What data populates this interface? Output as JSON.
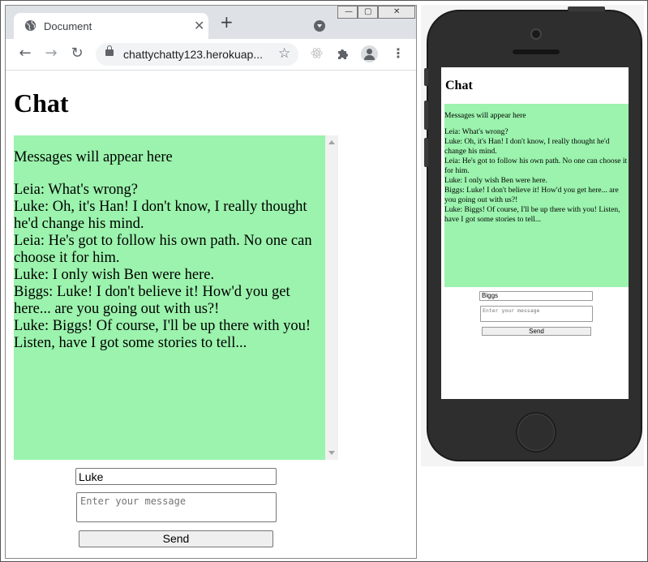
{
  "browser": {
    "tab_title": "Document",
    "tab_close": "✕",
    "new_tab": "+",
    "url": "chattychatty123.herokuap...",
    "back": "←",
    "forward": "→",
    "reload": "↻",
    "bookmark": "☆",
    "window_min": "—",
    "window_max": "▢",
    "window_close": "✕",
    "menu": "⋮"
  },
  "app": {
    "title": "Chat",
    "messages_placeholder": "Messages will appear here",
    "messages": [
      "Leia: What's wrong?",
      "Luke: Oh, it's Han! I don't know, I really thought he'd change his mind.",
      "Leia: He's got to follow his own path. No one can choose it for him.",
      "Luke: I only wish Ben were here.",
      "Biggs: Luke! I don't believe it! How'd you get here... are you going out with us?!",
      "Luke: Biggs! Of course, I'll be up there with you! Listen, have I got some stories to tell..."
    ],
    "name_value": "Luke",
    "message_placeholder": "Enter your message",
    "send_label": "Send"
  },
  "phone_app": {
    "title": "Chat",
    "messages_placeholder": "Messages will appear here",
    "messages": [
      "Leia: What's wrong?",
      "Luke: Oh, it's Han! I don't know, I really thought he'd change his mind.",
      "Leia: He's got to follow his own path. No one can choose it for him.",
      "Luke: I only wish Ben were here.",
      "Biggs: Luke! I don't believe it! How'd you get here... are you going out with us?!",
      "Luke: Biggs! Of course, I'll be up there with you! Listen, have I got some stories to tell..."
    ],
    "name_value": "Biggs",
    "message_placeholder": "Enter your message",
    "send_label": "Send"
  },
  "icons": {
    "favicon": "globe-icon",
    "lock": "lock-icon",
    "extensions": [
      "react-devtools-icon",
      "puzzle-icon"
    ],
    "profile": "avatar-icon"
  },
  "colors": {
    "message_box": "#9bf3ad",
    "tabstrip": "#dee1e6",
    "omnibox": "#f1f3f4"
  }
}
